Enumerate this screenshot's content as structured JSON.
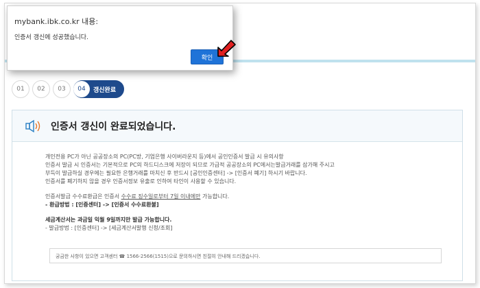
{
  "alert": {
    "title": "mybank.ibk.co.kr 내용:",
    "message": "인증서 갱신에 성공했습니다.",
    "ok_label": "확인"
  },
  "steps": [
    {
      "num": "01"
    },
    {
      "num": "02"
    },
    {
      "num": "03"
    },
    {
      "num": "04",
      "label": "갱신완료",
      "active": true
    }
  ],
  "panel": {
    "title": "인증서 갱신이 완료되었습니다.",
    "lines_1": [
      "개인전용 PC가 아닌 공공장소의 PC(PC방, 기업은행 사이버라운지 등)에서 공인인증서 발급 시 유의사항",
      "인증서 발급 시 인증서는 기본적으로 PC의 하드디스크에 저장이 되므로 가급적 공공장소의 PC에서는발급거래를 삼가해 주시고",
      "부득이 발급하실 경우에는 필요한 은행거래를 마치신 후 반드시 [공인인증센터] -> [인증서 폐기] 하시기 바랍니다.",
      "인증서를 폐기하지 않을 경우 인증서정보 유출로 인하여 타인이 사용할 수 있습니다."
    ],
    "refund": {
      "prefix": "인증서발급 수수료환급은 인증서 ",
      "underlined": "수수료 징수일로부터 7일 이내에만",
      "suffix": " 가능합니다.",
      "method": "- 환급방법 : [인증센터] -> [인증서 수수료환불]"
    },
    "tax": {
      "heading": "세금계산서는 과금일 익월 9일까지만 발급 가능합니다.",
      "method": "- 발급방법 : [인증센터] -> [세금계산서발행 신청/조회]"
    },
    "contact": "궁금한 사항이 있으면 고객센터 ☎ 1566-2566(1515)으로 문의하시면 친절히 안내해 드리겠습니다."
  },
  "colors": {
    "primary": "#1f73d8",
    "step_active": "#1e4a8c",
    "accent_bar": "#bfe1ee",
    "pointer": "#e02020"
  }
}
